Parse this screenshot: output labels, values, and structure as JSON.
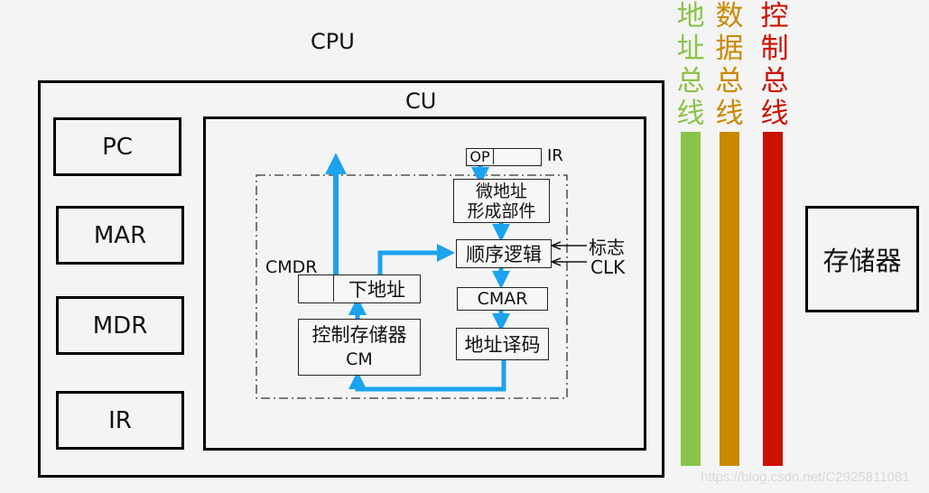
{
  "cpu": {
    "title": "CPU",
    "registers": [
      {
        "label": "PC"
      },
      {
        "label": "MAR"
      },
      {
        "label": "MDR"
      },
      {
        "label": "IR"
      }
    ]
  },
  "cu": {
    "title": "CU",
    "ir_op": "OP",
    "ir_label": "IR",
    "micro_addr_gen": "微地址\n形成部件",
    "micro_addr_gen_line1": "微地址",
    "micro_addr_gen_line2": "形成部件",
    "sequencer": "顺序逻辑",
    "flag_input": "标志",
    "clk_input": "CLK",
    "cmdr_label": "CMDR",
    "next_address": "下地址",
    "cmar": "CMAR",
    "addr_decoder": "地址译码",
    "control_memory_line1": "控制存储器",
    "control_memory_line2": "CM"
  },
  "buses": [
    {
      "label": "地址总线",
      "chars": [
        "地",
        "址",
        "总",
        "线"
      ],
      "color": "#8bc34a"
    },
    {
      "label": "数据总线",
      "chars": [
        "数",
        "据",
        "总",
        "线"
      ],
      "color": "#c98a00"
    },
    {
      "label": "控制总线",
      "chars": [
        "控",
        "制",
        "总",
        "线"
      ],
      "color": "#cc1100"
    }
  ],
  "memory": {
    "label": "存储器"
  },
  "arrow_color": "#1aa3ef",
  "watermark": "https://blog.csdn.net/C2925811081"
}
